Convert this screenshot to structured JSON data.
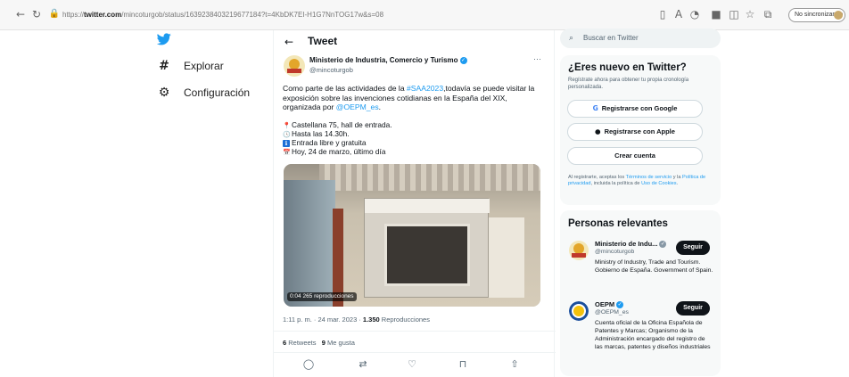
{
  "browser": {
    "url_prefix": "https://",
    "url_domain": "twitter.com",
    "url_path": "/mincoturgob/status/1639238403219677184?t=4KbDK7EI-H1G7NnTOG17w&s=08",
    "sync_label": "No sincronizando",
    "icons": [
      "back-icon",
      "refresh-icon",
      "home-icon",
      "reading-view-icon",
      "read-aloud-icon",
      "account-icon",
      "extension-icon",
      "extensions-icon",
      "favorites-icon",
      "collections-icon"
    ]
  },
  "nav": {
    "explore_label": "Explorar",
    "settings_label": "Configuración"
  },
  "main": {
    "title": "Tweet",
    "author_name": "Ministerio de Industria, Comercio y Turismo",
    "author_handle": "@mincoturgob",
    "body_prefix": "Como parte de las actividades de la ",
    "hashtag": "#SAA2023",
    "body_middle": ",todavía se puede visitar la exposición sobre las invenciones cotidianas en la España del XIX, organizada por ",
    "mention": "@OEPM_es",
    "body_suffix": ".",
    "lines": [
      {
        "icon": "📍",
        "text": "Castellana 75, hall de entrada."
      },
      {
        "icon": "🕓",
        "text": "Hasta las 14.30h."
      },
      {
        "icon": "ℹ",
        "text": "Entrada libre y gratuita"
      },
      {
        "icon": "📅",
        "text": "Hoy, 24 de marzo, último día"
      }
    ],
    "video_time": "0:04  265 reproducciones",
    "time": "1:11 p. m. · 24 mar. 2023 · ",
    "views": "1.350",
    "views_label": " Reproducciones",
    "retweets": "6",
    "retweets_label": " Retweets",
    "likes": "9",
    "likes_label": " Me gusta"
  },
  "sidebar": {
    "search_placeholder": "Buscar en Twitter",
    "new_title": "¿Eres nuevo en Twitter?",
    "new_sub": "Regístrate ahora para obtener tu propia cronología personalizada.",
    "google_label": "Registrarse con Google",
    "apple_label": "Registrarse con Apple",
    "create_label": "Crear cuenta",
    "legal_prefix": "Al registrarte, aceptas los ",
    "legal_terms": "Términos de servicio",
    "legal_mid": " y la ",
    "legal_privacy": "Política de privacidad",
    "legal_mid2": ", incluida la política de ",
    "legal_cookies": "Uso de Cookies",
    "legal_suffix": ".",
    "relevant_title": "Personas relevantes",
    "people": [
      {
        "name": "Ministerio de Indu...",
        "handle": "@mincoturgob",
        "bio": "Ministry of Industry, Trade and Tourism. Gobierno de España. Government of Spain.",
        "follow": "Seguir"
      },
      {
        "name": "OEPM",
        "handle": "@OEPM_es",
        "bio": "Cuenta oficial de la Oficina Española de Patentes y Marcas; Organismo de la Administración encargado del registro de las marcas, patentes y diseños industriales",
        "follow": "Seguir"
      }
    ]
  },
  "colors": {
    "accent": "#1d9bf0",
    "text": "#0f1419",
    "muted": "#536471"
  }
}
